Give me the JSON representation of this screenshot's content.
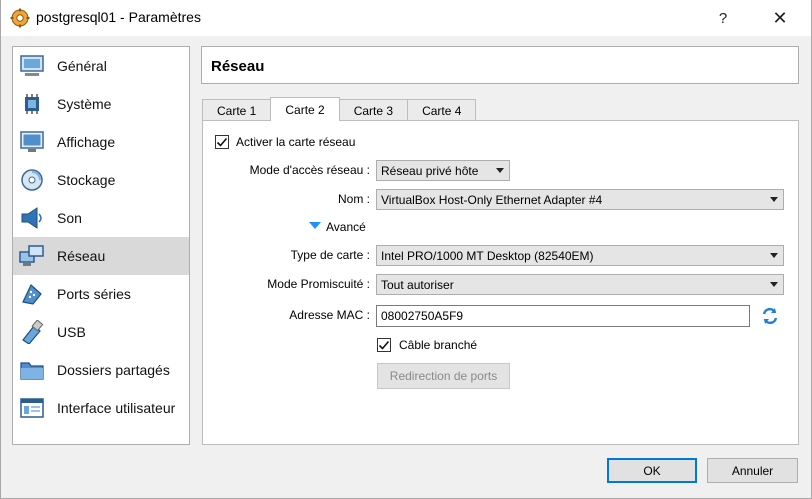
{
  "window": {
    "title": "postgresql01 - Paramètres",
    "help_label": "?",
    "close_label": "✕"
  },
  "sidebar": {
    "items": [
      {
        "label": "Général",
        "icon": "general-icon"
      },
      {
        "label": "Système",
        "icon": "system-icon"
      },
      {
        "label": "Affichage",
        "icon": "display-icon"
      },
      {
        "label": "Stockage",
        "icon": "storage-icon"
      },
      {
        "label": "Son",
        "icon": "sound-icon"
      },
      {
        "label": "Réseau",
        "icon": "network-icon",
        "selected": true
      },
      {
        "label": "Ports séries",
        "icon": "serial-ports-icon"
      },
      {
        "label": "USB",
        "icon": "usb-icon"
      },
      {
        "label": "Dossiers partagés",
        "icon": "shared-folders-icon"
      },
      {
        "label": "Interface utilisateur",
        "icon": "user-interface-icon"
      }
    ]
  },
  "main": {
    "header": "Réseau",
    "tabs": [
      {
        "label": "Carte 1"
      },
      {
        "label": "Carte 2",
        "active": true
      },
      {
        "label": "Carte 3"
      },
      {
        "label": "Carte 4"
      }
    ],
    "enable_adapter_label": "Activer la carte réseau",
    "enable_adapter_checked": true,
    "attached_to": {
      "label": "Mode d'accès réseau :",
      "value": "Réseau privé hôte"
    },
    "name": {
      "label": "Nom :",
      "value": "VirtualBox Host-Only Ethernet Adapter #4"
    },
    "advanced_label": "Avancé",
    "adapter_type": {
      "label": "Type de carte :",
      "value": "Intel PRO/1000 MT Desktop (82540EM)"
    },
    "promiscuous": {
      "label": "Mode Promiscuité :",
      "value": "Tout autoriser"
    },
    "mac": {
      "label": "Adresse MAC :",
      "value": "08002750A5F9"
    },
    "cable_connected_label": "Câble branché",
    "cable_connected_checked": true,
    "port_forwarding_label": "Redirection de ports"
  },
  "footer": {
    "ok_label": "OK",
    "cancel_label": "Annuler"
  },
  "colors": {
    "accent": "#0078d7",
    "selected_bg": "#d9d9d9",
    "advanced_triangle": "#1e90ff"
  }
}
